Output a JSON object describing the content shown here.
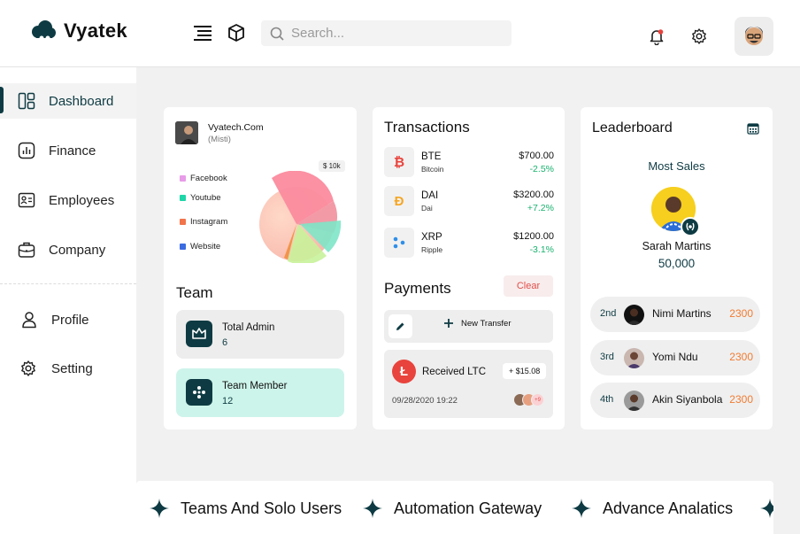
{
  "app": {
    "name": "Vyatek"
  },
  "search": {
    "placeholder": "Search..."
  },
  "sidebar": {
    "items": [
      {
        "label": "Dashboard",
        "icon": "dashboard-icon",
        "active": true
      },
      {
        "label": "Finance",
        "icon": "finance-icon"
      },
      {
        "label": "Employees",
        "icon": "employees-icon"
      },
      {
        "label": "Company",
        "icon": "briefcase-icon"
      },
      {
        "label": "Profile",
        "icon": "user-icon"
      },
      {
        "label": "Setting",
        "icon": "settings-icon"
      }
    ]
  },
  "profile_card": {
    "name": "Vyatech.Com",
    "subtitle": "(Misti)",
    "pie_tag": "$ 10k",
    "legend": [
      {
        "label": "Facebook",
        "color": "#e89be8"
      },
      {
        "label": "Youtube",
        "color": "#1fd6a8"
      },
      {
        "label": "Instagram",
        "color": "#f2744b"
      },
      {
        "label": "Website",
        "color": "#3b6be0"
      }
    ]
  },
  "team": {
    "title": "Team",
    "items": [
      {
        "label": "Total Admin",
        "count": "6"
      },
      {
        "label": "Team Member",
        "count": "12"
      }
    ]
  },
  "transactions": {
    "title": "Transactions",
    "items": [
      {
        "symbol": "BTE",
        "name": "Bitcoin",
        "amount": "$700.00",
        "change": "-2.5%",
        "icon": "bitcoin-icon",
        "color": "#e8433c"
      },
      {
        "symbol": "DAI",
        "name": "Dai",
        "amount": "$3200.00",
        "change": "+7.2%",
        "icon": "dai-icon",
        "color": "#f5a623"
      },
      {
        "symbol": "XRP",
        "name": "Ripple",
        "amount": "$1200.00",
        "change": "-3.1%",
        "icon": "ripple-icon",
        "color": "#2f8fe8"
      }
    ]
  },
  "payments": {
    "title": "Payments",
    "clear_label": "Clear",
    "new_transfer_label": "New Transfer",
    "received": {
      "label": "Received LTC",
      "amount": "+ $15.08",
      "date": "09/28/2020 19:22",
      "extra_count": "+9"
    }
  },
  "leaderboard": {
    "title": "Leaderboard",
    "subtitle": "Most Sales",
    "winner": {
      "name": "Sarah Martins",
      "score": "50,000"
    },
    "ranks": [
      {
        "pos": "2nd",
        "name": "Nimi Martins",
        "score": "2300"
      },
      {
        "pos": "3rd",
        "name": "Yomi Ndu",
        "score": "2300"
      },
      {
        "pos": "4th",
        "name": "Akin Siyanbola",
        "score": "2300"
      }
    ]
  },
  "ticker": {
    "items": [
      "Teams And Solo Users",
      "Automation Gateway",
      "Advance Analatics"
    ]
  },
  "colors": {
    "accent": "#0e3b43",
    "negative_clear": "#e0504a",
    "score": "#f07c32"
  }
}
